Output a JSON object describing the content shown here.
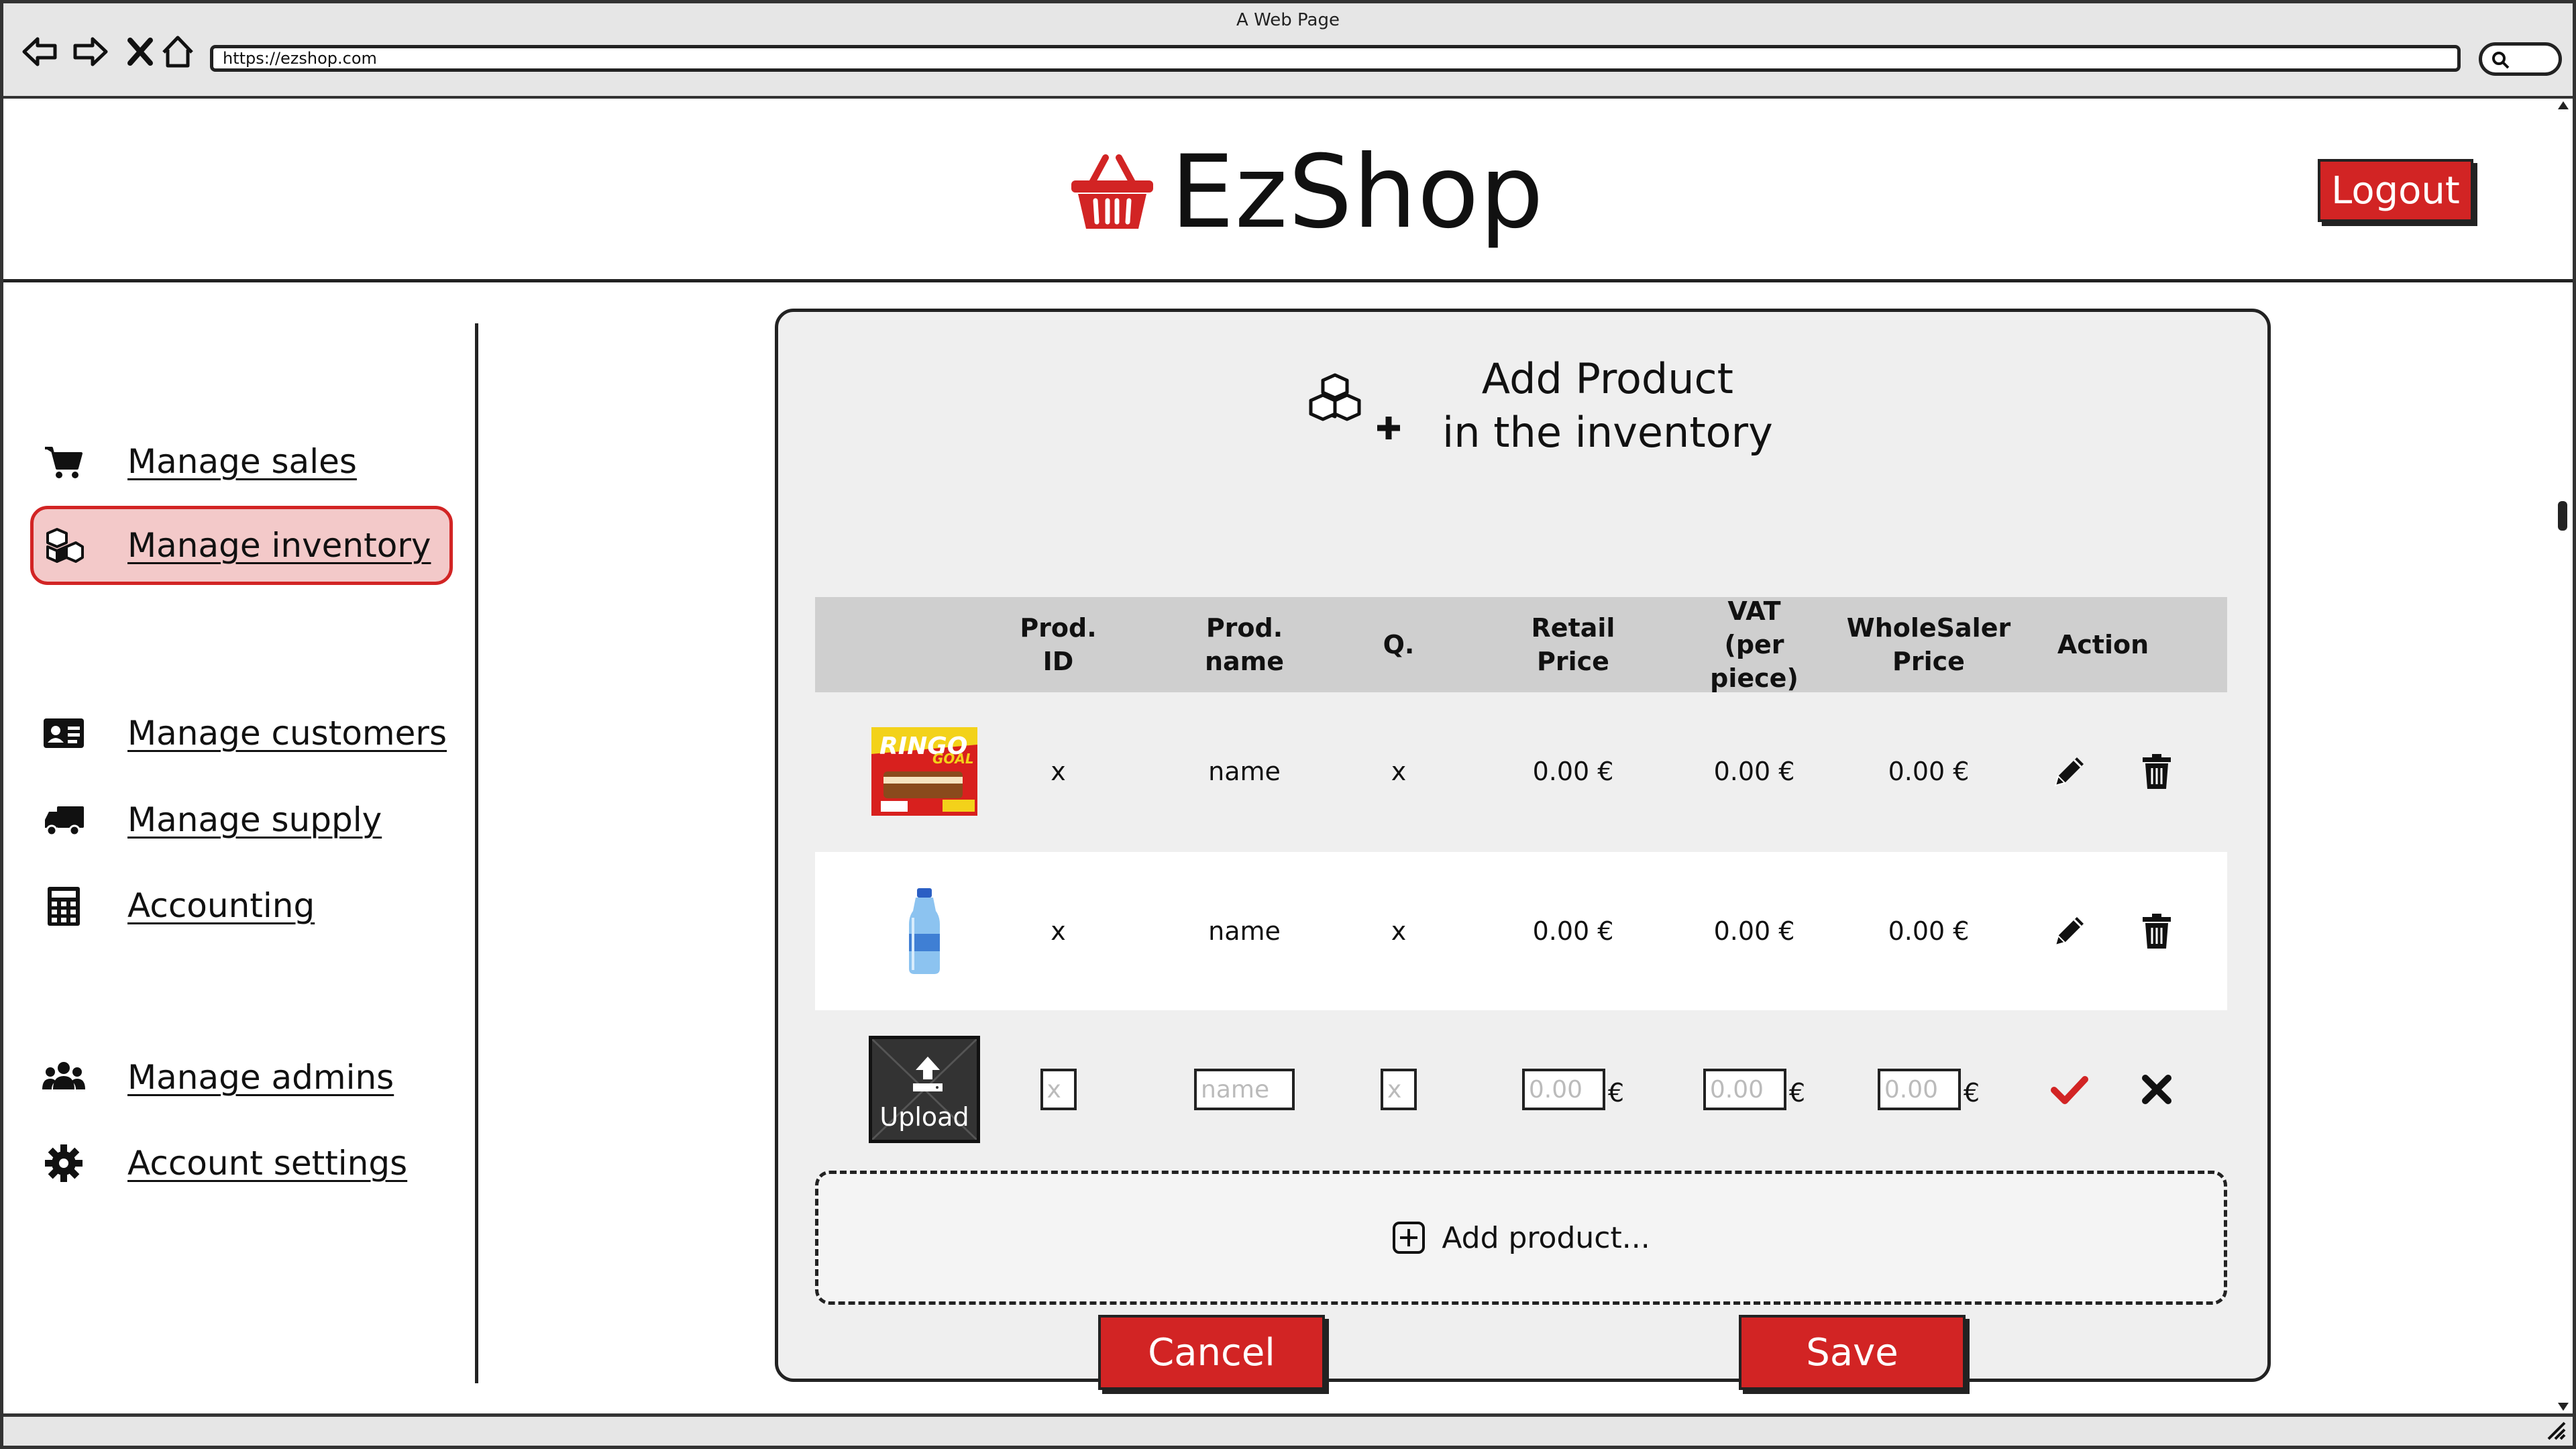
{
  "browser": {
    "title": "A Web Page",
    "url": "https://ezshop.com"
  },
  "header": {
    "brand": "EzShop",
    "logout_label": "Logout",
    "accent_color": "#d22424"
  },
  "sidebar": {
    "items": [
      {
        "label": "Manage sales",
        "icon": "cart-icon",
        "active": false
      },
      {
        "label": "Manage inventory",
        "icon": "cubes-icon",
        "active": true
      },
      {
        "label": "Manage customers",
        "icon": "id-card-icon",
        "active": false
      },
      {
        "label": "Manage supply",
        "icon": "truck-icon",
        "active": false
      },
      {
        "label": "Accounting",
        "icon": "calculator-icon",
        "active": false
      },
      {
        "label": "Manage admins",
        "icon": "users-icon",
        "active": false
      },
      {
        "label": "Account settings",
        "icon": "gear-icon",
        "active": false
      }
    ]
  },
  "panel": {
    "title_line1": "Add Product",
    "title_line2": "in the inventory",
    "columns": {
      "id": "Prod. ID",
      "name_l1": "Prod.",
      "name_l2": "name",
      "qty": "Q.",
      "retail_l1": "Retail",
      "retail_l2": "Price",
      "vat_l1": "VAT",
      "vat_l2": "(per piece)",
      "wholesale_l1": "WholeSaler",
      "wholesale_l2": "Price",
      "action": "Action"
    },
    "rows": [
      {
        "image": "snack-package-image",
        "id": "x",
        "name": "name",
        "qty": "x",
        "retail": "0.00 €",
        "vat": "0.00 €",
        "wholesale": "0.00 €"
      },
      {
        "image": "water-bottle-image",
        "id": "x",
        "name": "name",
        "qty": "x",
        "retail": "0.00 €",
        "vat": "0.00 €",
        "wholesale": "0.00 €"
      }
    ],
    "new_row": {
      "upload_label": "Upload",
      "id_placeholder": "x",
      "name_placeholder": "name",
      "qty_placeholder": "x",
      "retail_placeholder": "0.00",
      "vat_placeholder": "0.00",
      "wholesale_placeholder": "0.00",
      "currency": "€"
    },
    "add_product_label": "Add product...",
    "cancel_label": "Cancel",
    "save_label": "Save"
  }
}
